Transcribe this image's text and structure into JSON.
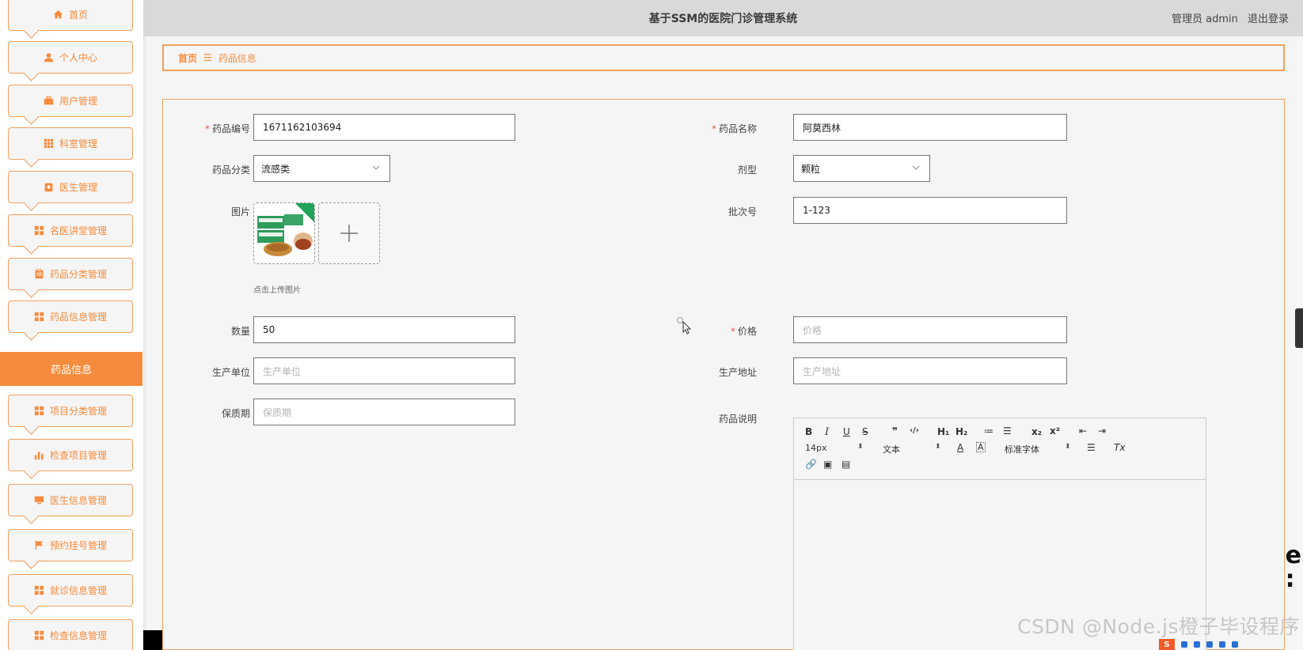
{
  "app": {
    "title": "基于SSM的医院门诊管理系统",
    "user_label": "管理员 admin",
    "logout_label": "退出登录"
  },
  "sidebar": {
    "items": [
      {
        "label": "首页",
        "icon": "home-icon"
      },
      {
        "label": "个人中心",
        "icon": "user-icon"
      },
      {
        "label": "用户管理",
        "icon": "briefcase-icon"
      },
      {
        "label": "科室管理",
        "icon": "grid-icon"
      },
      {
        "label": "医生管理",
        "icon": "doctor-icon"
      },
      {
        "label": "名医讲堂管理",
        "icon": "apps-icon"
      },
      {
        "label": "药品分类管理",
        "icon": "clipboard-icon"
      },
      {
        "label": "药品信息管理",
        "icon": "apps-icon"
      },
      {
        "label": "项目分类管理",
        "icon": "apps-icon"
      },
      {
        "label": "检查项目管理",
        "icon": "bar-chart-icon"
      },
      {
        "label": "医生信息管理",
        "icon": "monitor-icon"
      },
      {
        "label": "预约挂号管理",
        "icon": "flag-icon"
      },
      {
        "label": "就诊信息管理",
        "icon": "apps-icon"
      },
      {
        "label": "检查信息管理",
        "icon": "apps-icon"
      }
    ],
    "active_sub": "药品信息"
  },
  "breadcrumb": {
    "home": "首页",
    "separator": "☰",
    "current": "药品信息"
  },
  "form": {
    "drug_code": {
      "label": "药品编号",
      "value": "1671162103694",
      "required": true
    },
    "drug_name": {
      "label": "药品名称",
      "value": "阿莫西林",
      "required": true
    },
    "category": {
      "label": "药品分类",
      "value": "流感类"
    },
    "dosage": {
      "label": "剂型",
      "value": "颗粒"
    },
    "image": {
      "label": "图片",
      "hint": "点击上传图片"
    },
    "batch": {
      "label": "批次号",
      "value": "1-123"
    },
    "quantity": {
      "label": "数量",
      "value": "50"
    },
    "price": {
      "label": "价格",
      "placeholder": "价格",
      "required": true
    },
    "manufacturer": {
      "label": "生产单位",
      "placeholder": "生产单位"
    },
    "address": {
      "label": "生产地址",
      "placeholder": "生产地址"
    },
    "shelf_life": {
      "label": "保质期",
      "placeholder": "保质期"
    },
    "description": {
      "label": "药品说明"
    }
  },
  "editor": {
    "font_size": "14px",
    "text_style": "文本",
    "font_family": "标准字体",
    "toolbar_row1": [
      "B",
      "I",
      "U",
      "S",
      "❞",
      "‹/›",
      "H₁",
      "H₂",
      "≔",
      "☰",
      "x₂",
      "x²",
      "⇤",
      "⇥"
    ],
    "toolbar_row1_names": [
      "bold-button",
      "italic-button",
      "underline-button",
      "strike-button",
      "quote-button",
      "code-button",
      "h1-button",
      "h2-button",
      "ordered-list-button",
      "bullet-list-button",
      "subscript-button",
      "superscript-button",
      "outdent-button",
      "indent-button"
    ]
  },
  "watermark": "CSDN @Node.js橙子毕设程序",
  "colors": {
    "accent": "#f58b3c",
    "header_bg": "#d9d9d9",
    "required": "#e25c4b"
  }
}
